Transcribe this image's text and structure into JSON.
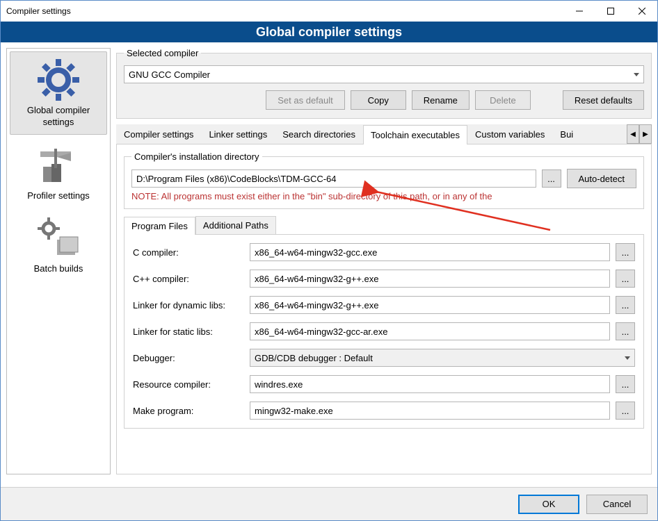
{
  "window": {
    "title": "Compiler settings"
  },
  "header": {
    "title": "Global compiler settings"
  },
  "sidebar": {
    "items": [
      {
        "label": "Global compiler settings"
      },
      {
        "label": "Profiler settings"
      },
      {
        "label": "Batch builds"
      }
    ]
  },
  "selected_compiler": {
    "legend": "Selected compiler",
    "value": "GNU GCC Compiler",
    "buttons": {
      "set_default": "Set as default",
      "copy": "Copy",
      "rename": "Rename",
      "delete": "Delete",
      "reset": "Reset defaults"
    }
  },
  "tabs": {
    "items": [
      "Compiler settings",
      "Linker settings",
      "Search directories",
      "Toolchain executables",
      "Custom variables",
      "Bui"
    ],
    "active_index": 3
  },
  "install_dir": {
    "legend": "Compiler's installation directory",
    "value": "D:\\Program Files (x86)\\CodeBlocks\\TDM-GCC-64",
    "browse": "...",
    "auto_detect": "Auto-detect",
    "note": "NOTE: All programs must exist either in the \"bin\" sub-directory of this path, or in any of the"
  },
  "subtabs": {
    "items": [
      "Program Files",
      "Additional Paths"
    ],
    "active_index": 0
  },
  "programs": {
    "c_compiler": {
      "label": "C compiler:",
      "value": "x86_64-w64-mingw32-gcc.exe"
    },
    "cpp_compiler": {
      "label": "C++ compiler:",
      "value": "x86_64-w64-mingw32-g++.exe"
    },
    "linker_dyn": {
      "label": "Linker for dynamic libs:",
      "value": "x86_64-w64-mingw32-g++.exe"
    },
    "linker_static": {
      "label": "Linker for static libs:",
      "value": "x86_64-w64-mingw32-gcc-ar.exe"
    },
    "debugger": {
      "label": "Debugger:",
      "value": "GDB/CDB debugger : Default"
    },
    "resource": {
      "label": "Resource compiler:",
      "value": "windres.exe"
    },
    "make": {
      "label": "Make program:",
      "value": "mingw32-make.exe"
    }
  },
  "footer": {
    "ok": "OK",
    "cancel": "Cancel"
  }
}
